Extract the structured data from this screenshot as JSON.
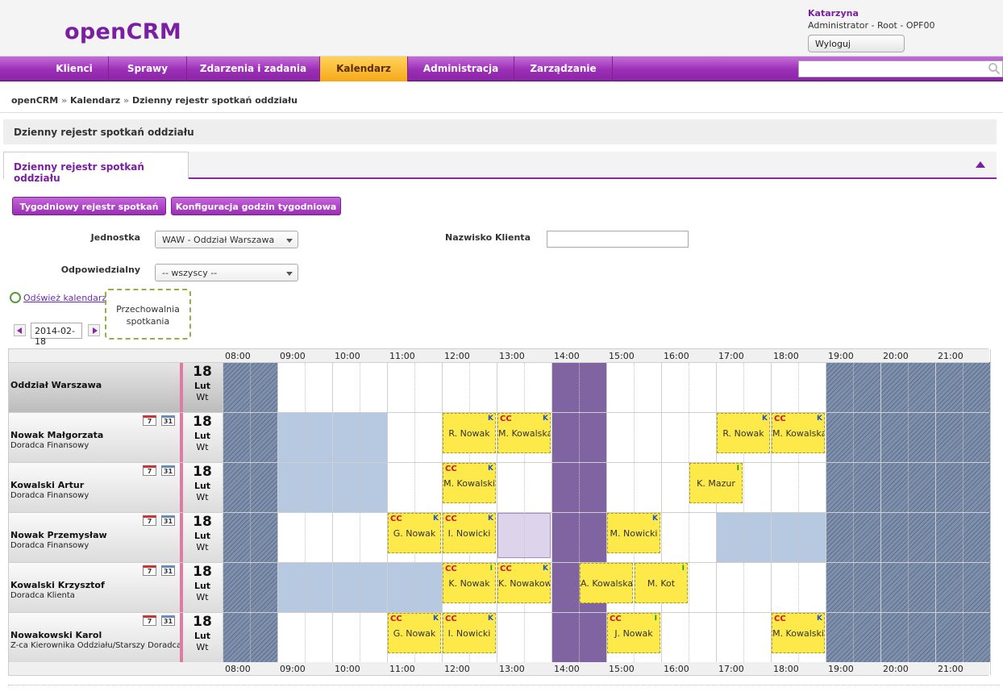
{
  "app": {
    "logo": "openCRM",
    "user_name": "Katarzyna",
    "user_role": "Administrator - Root - OPF00",
    "logout_label": "Wyloguj"
  },
  "nav": {
    "items": [
      "Klienci",
      "Sprawy",
      "Zdarzenia i zadania",
      "Kalendarz",
      "Administracja",
      "Zarządzanie"
    ],
    "active": "Kalendarz",
    "search_placeholder": ""
  },
  "breadcrumb": {
    "items": [
      "openCRM",
      "Kalendarz",
      "Dzienny rejestr spotkań oddziału"
    ],
    "separator": "»"
  },
  "page": {
    "section_title": "Dzienny rejestr spotkań oddziału",
    "tab_title": "Dzienny rejestr spotkań oddziału",
    "btn_weekly": "Tygodniowy rejestr spotkań",
    "btn_config": "Konfiguracja godzin tygodniowa",
    "unit_label": "Jednostka",
    "unit_value": "WAW - Oddział Warszawa",
    "client_label": "Nazwisko Klienta",
    "client_value": "",
    "resp_label": "Odpowiedzialny",
    "resp_value": "-- wszyscy --",
    "refresh_label": "Odśwież kalendarz",
    "storage_label": "Przechowalnia spotkania",
    "date": "2014-02-18"
  },
  "calendar": {
    "hours": [
      "08:00",
      "09:00",
      "10:00",
      "11:00",
      "12:00",
      "13:00",
      "14:00",
      "15:00",
      "16:00",
      "17:00",
      "18:00",
      "19:00",
      "20:00",
      "21:00"
    ],
    "day": {
      "num": "18",
      "month": "Lut",
      "weekday": "Wt"
    },
    "cal_icon_day": "7",
    "cal_icon_month": "31",
    "rows": [
      {
        "name": "Oddział Warszawa",
        "role": "",
        "header": true
      },
      {
        "name": "Nowak Małgorzata",
        "role": "Doradca Finansowy"
      },
      {
        "name": "Kowalski Artur",
        "role": "Doradca Finansowy"
      },
      {
        "name": "Nowak Przemysław",
        "role": "Doradca Finansowy"
      },
      {
        "name": "Kowalski Krzysztof",
        "role": "Doradca Klienta"
      },
      {
        "name": "Nowakowski Karol",
        "role": "Z-ca Kierownika Oddziału/Starszy Doradca Finansowy"
      }
    ],
    "appointments": [
      {
        "row": 1,
        "start": 12,
        "who": "R. Nowak",
        "cc": false,
        "tag": "K"
      },
      {
        "row": 1,
        "start": 13,
        "who": "M. Kowalska",
        "cc": true,
        "tag": "K"
      },
      {
        "row": 1,
        "start": 17,
        "who": "R. Nowak",
        "cc": false,
        "tag": "K"
      },
      {
        "row": 1,
        "start": 18,
        "who": "M. Kowalska",
        "cc": true,
        "tag": "K"
      },
      {
        "row": 2,
        "start": 12,
        "who": "M. Kowalski",
        "cc": true,
        "tag": "K"
      },
      {
        "row": 2,
        "start": 16.5,
        "who": "K. Mazur",
        "cc": false,
        "tag": "I"
      },
      {
        "row": 3,
        "start": 11,
        "who": "G. Nowak",
        "cc": true,
        "tag": "K"
      },
      {
        "row": 3,
        "start": 12,
        "who": "I. Nowicki",
        "cc": true,
        "tag": "K"
      },
      {
        "row": 3,
        "start": 15,
        "who": "M. Nowicki",
        "cc": false,
        "tag": "K"
      },
      {
        "row": 4,
        "start": 12,
        "who": "K. Nowak",
        "cc": true,
        "tag": "I"
      },
      {
        "row": 4,
        "start": 13,
        "who": "K. Nowakowa",
        "cc": true,
        "tag": "K"
      },
      {
        "row": 4,
        "start": 14.5,
        "who": "A. Kowalska",
        "cc": false,
        "tag": ""
      },
      {
        "row": 4,
        "start": 15.5,
        "who": "M. Kot",
        "cc": false,
        "tag": "I"
      },
      {
        "row": 5,
        "start": 11,
        "who": "G. Nowak",
        "cc": true,
        "tag": "K"
      },
      {
        "row": 5,
        "start": 12,
        "who": "I. Nowicki",
        "cc": true,
        "tag": "K"
      },
      {
        "row": 5,
        "start": 15,
        "who": "J. Nowak",
        "cc": true,
        "tag": "I"
      },
      {
        "row": 5,
        "start": 18,
        "who": "M. Kowalski",
        "cc": true,
        "tag": "K"
      }
    ],
    "cc_label": "CC",
    "status_colors": {
      "closed": "#6e7f9c",
      "lunch": "#7f64a1",
      "available": "#b6c9e1",
      "pending": "#ddd4ec",
      "appointment": "#fde94a"
    }
  },
  "colors": {
    "brand": "#7a1fa2",
    "nav_active": "#f6a818"
  }
}
